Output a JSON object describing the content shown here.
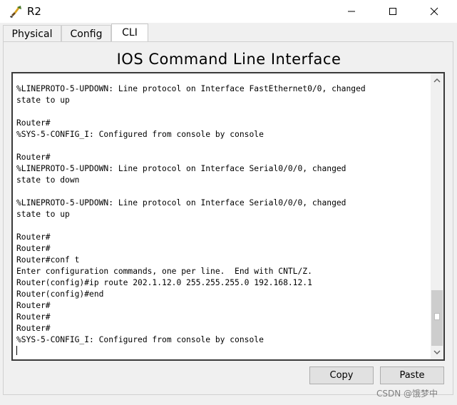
{
  "window": {
    "title": "R2"
  },
  "tabs": [
    {
      "label": "Physical"
    },
    {
      "label": "Config"
    },
    {
      "label": "CLI"
    }
  ],
  "active_tab": "CLI",
  "panel": {
    "title": "IOS Command Line Interface"
  },
  "terminal": {
    "lines": [
      "%LINEPROTO-5-UPDOWN: Line protocol on Interface FastEthernet0/0, changed",
      "state to up",
      "",
      "Router#",
      "%SYS-5-CONFIG_I: Configured from console by console",
      "",
      "Router#",
      "%LINEPROTO-5-UPDOWN: Line protocol on Interface Serial0/0/0, changed",
      "state to down",
      "",
      "%LINEPROTO-5-UPDOWN: Line protocol on Interface Serial0/0/0, changed",
      "state to up",
      "",
      "Router#",
      "Router#",
      "Router#conf t",
      "Enter configuration commands, one per line.  End with CNTL/Z.",
      "Router(config)#ip route 202.1.12.0 255.255.255.0 192.168.12.1",
      "Router(config)#end",
      "Router#",
      "Router#",
      "Router#",
      "%SYS-5-CONFIG_I: Configured from console by console",
      ""
    ]
  },
  "buttons": {
    "copy": "Copy",
    "paste": "Paste"
  },
  "watermark": "CSDN @饿梦中",
  "colors": {
    "terminal_bg": "#ffffff",
    "terminal_border": "#3a3a3a",
    "button_bg": "#e1e1e1"
  },
  "icons": [
    "router-app-icon",
    "minimize-icon",
    "maximize-icon",
    "close-icon",
    "scroll-up-arrow-icon",
    "scroll-down-arrow-icon"
  ]
}
